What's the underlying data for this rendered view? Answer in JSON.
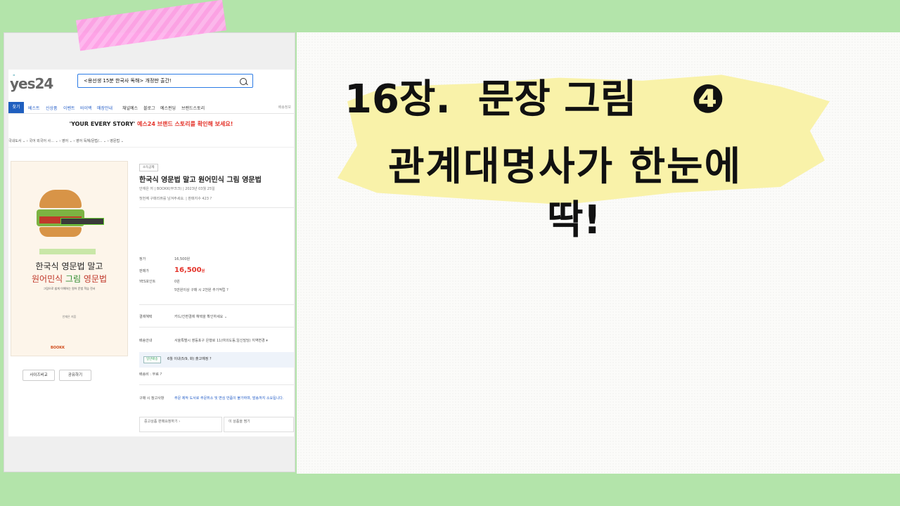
{
  "heading": {
    "line1": "16장.  문장 그림    ❹",
    "line2": "관계대명사가 한눈에",
    "line3": "딱!"
  },
  "colors": {
    "background": "#b3e4aa",
    "highlight": "#f9f1a4",
    "tape": "#ffb5ee",
    "brand_blue": "#1f5fbf",
    "price_red": "#e4342b"
  },
  "screenshot": {
    "logo": "yes24",
    "search_value": "<용선생 15분 한국사 독해> 개정판 출간!",
    "nav": {
      "first": "찾기",
      "items": [
        "베스트",
        "신상품",
        "이벤트",
        "바이백",
        "매장안내"
      ],
      "items_dark": [
        "채널예스",
        "블로그",
        "예스펀딩",
        "브랜드스토리"
      ],
      "right": "배송정보"
    },
    "banner": {
      "prefix": "'YOUR EVERY STORY'",
      "suffix": "예스24 브랜드 스토리를 확인해 보세요!"
    },
    "breadcrumb": "국내도서 ⌄ › 국어 외국어 사... ⌄ › 영어 ⌄ › 영어 독해/문법/... ⌄ › 영문법 ⌄",
    "cover": {
      "title1": "한국식 영문법 말고",
      "title2_a": "원어민식 ",
      "title2_b": "그림",
      "title2_c": " 영문법",
      "subtitle": "그림으로 쉽게 이해하는 원어 문법 학습 전서",
      "author": "안재은 지음",
      "publisher": "BOOKK"
    },
    "buttons": {
      "size_compare": "사이즈비교",
      "share": "공유하기"
    },
    "book": {
      "tag": "소득공제",
      "title": "한국식 영문법 말고 원어민식 그림 영문법",
      "meta1": "안재은 저  |  BOOKK(부크크)  |  2023년 03월 25일",
      "meta2": "첫번째 구매리뷰를 남겨주세요.  |  판매지수 423 ?"
    },
    "price": {
      "list_label": "정가",
      "list_value": "16,500원",
      "sale_label": "판매가",
      "sale_value": "16,500",
      "sale_unit": "원",
      "points_label": "YES포인트",
      "points_value": "0원",
      "points_note": "5만원이상 구매 시 2천원 추가적립 ?"
    },
    "benefit": {
      "label": "결제혜택",
      "value": "카드/간편결제 혜택을 확인하세요 ⌄"
    },
    "shipping": {
      "label": "배송안내",
      "value": "서울특별시 영등포구 은행로 11(여의도동,일신빌딩) 지역변경 ▾"
    },
    "delivery": {
      "pill": "일반배송",
      "text": "6월 이내(5/9, 화) 출고예정 ?"
    },
    "shipping_fee": "배송비 : 무료 ?",
    "note": {
      "label": "구매 시 참고사항",
      "value": "주문 제작 도서로 주문취소 및 변심 반품이 불가하며, 발송까지 소요됩니다."
    },
    "bottom": {
      "used": "중고상품 판매요청하기 ›",
      "other": "이 상품을 찜기"
    }
  }
}
